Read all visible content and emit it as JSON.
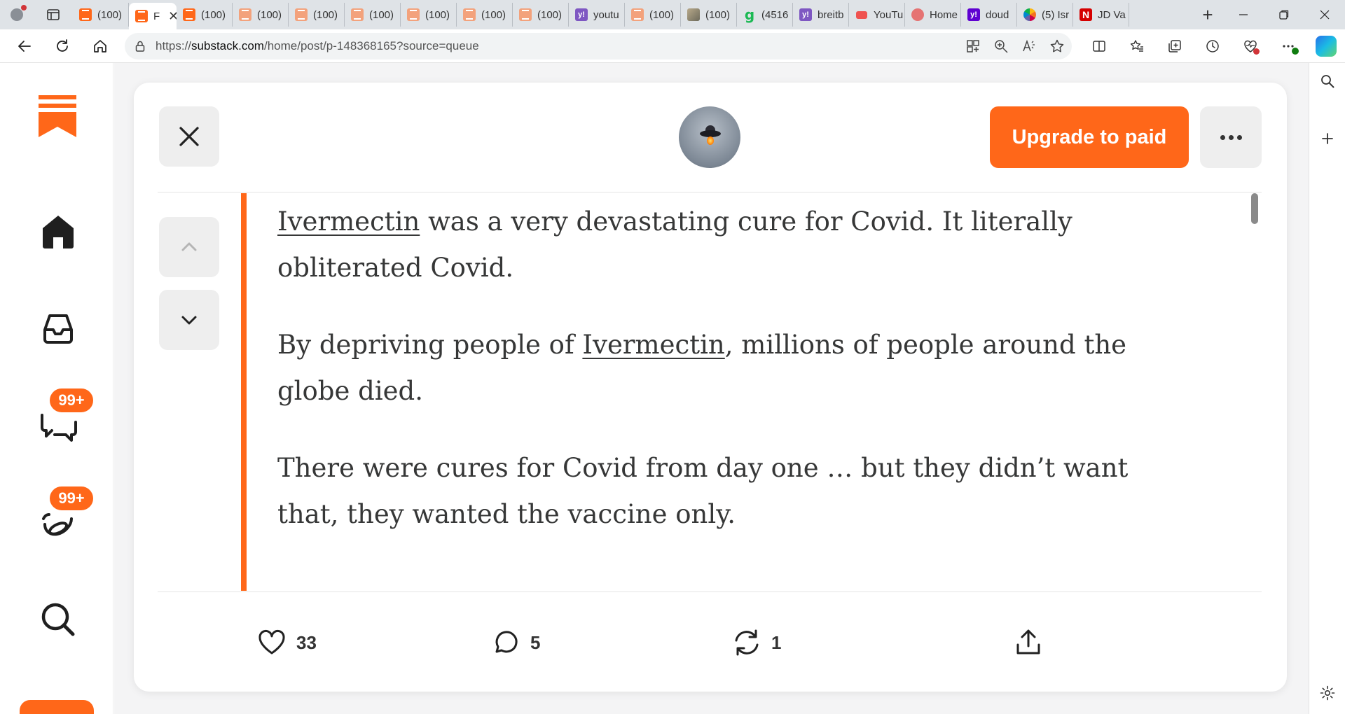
{
  "browser": {
    "tabs": [
      {
        "favicon": "substack",
        "title": "(100)",
        "faded": false
      },
      {
        "favicon": "substack",
        "title": "F",
        "active": true
      },
      {
        "favicon": "substack",
        "title": "(100)",
        "faded": false
      },
      {
        "favicon": "substack",
        "title": "(100)",
        "faded": true
      },
      {
        "favicon": "substack",
        "title": "(100)",
        "faded": true
      },
      {
        "favicon": "substack",
        "title": "(100)",
        "faded": true
      },
      {
        "favicon": "substack",
        "title": "(100)",
        "faded": true
      },
      {
        "favicon": "substack",
        "title": "(100)",
        "faded": true
      },
      {
        "favicon": "substack",
        "title": "(100)",
        "faded": true
      },
      {
        "favicon": "yahoo",
        "title": "youtu"
      },
      {
        "favicon": "substack",
        "title": "(100)",
        "faded": true
      },
      {
        "favicon": "image",
        "title": "(100)"
      },
      {
        "favicon": "grammarly-g",
        "title": "(4516"
      },
      {
        "favicon": "yahoo",
        "title": "breitb"
      },
      {
        "favicon": "youtube",
        "title": "YouTu"
      },
      {
        "favicon": "pinterest",
        "title": "Home"
      },
      {
        "favicon": "yahoo-dark",
        "title": "doud"
      },
      {
        "favicon": "nbc-peacock",
        "title": "(5) Isr"
      },
      {
        "favicon": "newsmax-n",
        "title": "JD Va"
      }
    ],
    "url": {
      "prefix": "https://",
      "host": "substack.com",
      "path": "/home/post/p-148368165?source=queue"
    }
  },
  "sidebar": {
    "chat_badge": "99+",
    "activity_badge": "99+"
  },
  "post": {
    "upgrade_label": "Upgrade to paid",
    "paragraphs": [
      {
        "link": "Ivermectin",
        "rest": " was a very devastating cure for Covid. It literally obliterated Covid."
      },
      {
        "before": "By depriving people of ",
        "link": "Ivermectin",
        "rest": ", millions of people around the globe died."
      },
      {
        "text": "There were cures for Covid from day one … but they didn’t want that, they wanted the vaccine only."
      }
    ],
    "likes": "33",
    "comments": "5",
    "restacks": "1"
  },
  "colors": {
    "accent": "#ff6719",
    "text": "#363737"
  }
}
